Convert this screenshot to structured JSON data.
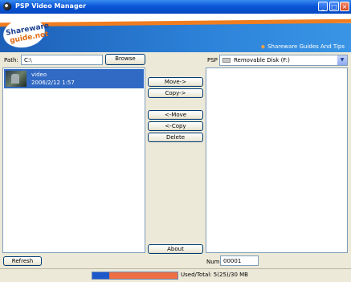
{
  "window": {
    "title": "PSP Video Manager"
  },
  "banner": {
    "logo_top": "Shareware",
    "logo_bottom": "guide.net",
    "tagline": "Shareware Guides And Tips"
  },
  "left": {
    "path_label": "Path:",
    "path_value": "C:\\",
    "browse_label": "Browse",
    "files": [
      {
        "name": "video",
        "date": "2006/2/12 1:57"
      }
    ]
  },
  "middle": {
    "move_right": "Move->",
    "copy_right": "Copy->",
    "move_left": "<-Move",
    "copy_left": "<-Copy",
    "delete": "Delete",
    "about": "About"
  },
  "right": {
    "psp_label": "PSP",
    "drive_value": "Removable Disk (F:)",
    "num_label": "Num",
    "num_value": "00001"
  },
  "bottom": {
    "refresh_label": "Refresh",
    "storage_text": "Used/Total: 5(25)/30 MB",
    "used_fraction": 0.2
  },
  "colors": {
    "titlebar": "#0a56d8",
    "selection": "#316ac5",
    "accent_orange": "#f07d1f"
  }
}
